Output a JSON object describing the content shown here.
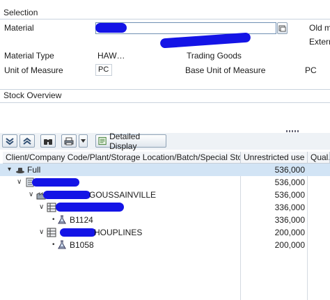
{
  "selection": {
    "title": "Selection",
    "material_label": "Material",
    "material_value": "",
    "right_label_1": "Old ma",
    "right_label_2": "Extern",
    "material_type_label": "Material Type",
    "material_type_value": "HAW…",
    "material_type_desc": "Trading Goods",
    "uom_label": "Unit of Measure",
    "uom_value": "PC",
    "base_uom_label": "Base Unit of Measure",
    "base_uom_value": "PC"
  },
  "stock_overview": {
    "title": "Stock Overview"
  },
  "toolbar": {
    "detailed_display_label": "Detailed Display"
  },
  "table": {
    "columns": [
      "Client/Company Code/Plant/Storage Location/Batch/Special Stock",
      "Unrestricted use",
      "Qual."
    ],
    "rows": [
      {
        "label": "Full",
        "qty": "536,000",
        "level": 0,
        "icon": "hat-icon"
      },
      {
        "label": "",
        "qty": "536,000",
        "level": 1,
        "icon": "company-icon"
      },
      {
        "label": "GOUSSAINVILLE",
        "qty": "536,000",
        "level": 2,
        "icon": "plant-icon"
      },
      {
        "label": "",
        "qty": "336,000",
        "level": 3,
        "icon": "storage-icon"
      },
      {
        "label": "B1124",
        "qty": "336,000",
        "level": 4,
        "icon": "batch-icon"
      },
      {
        "label": "HOUPLINES",
        "qty": "200,000",
        "level": 3,
        "icon": "storage-icon"
      },
      {
        "label": "B1058",
        "qty": "200,000",
        "level": 4,
        "icon": "batch-icon"
      }
    ]
  }
}
